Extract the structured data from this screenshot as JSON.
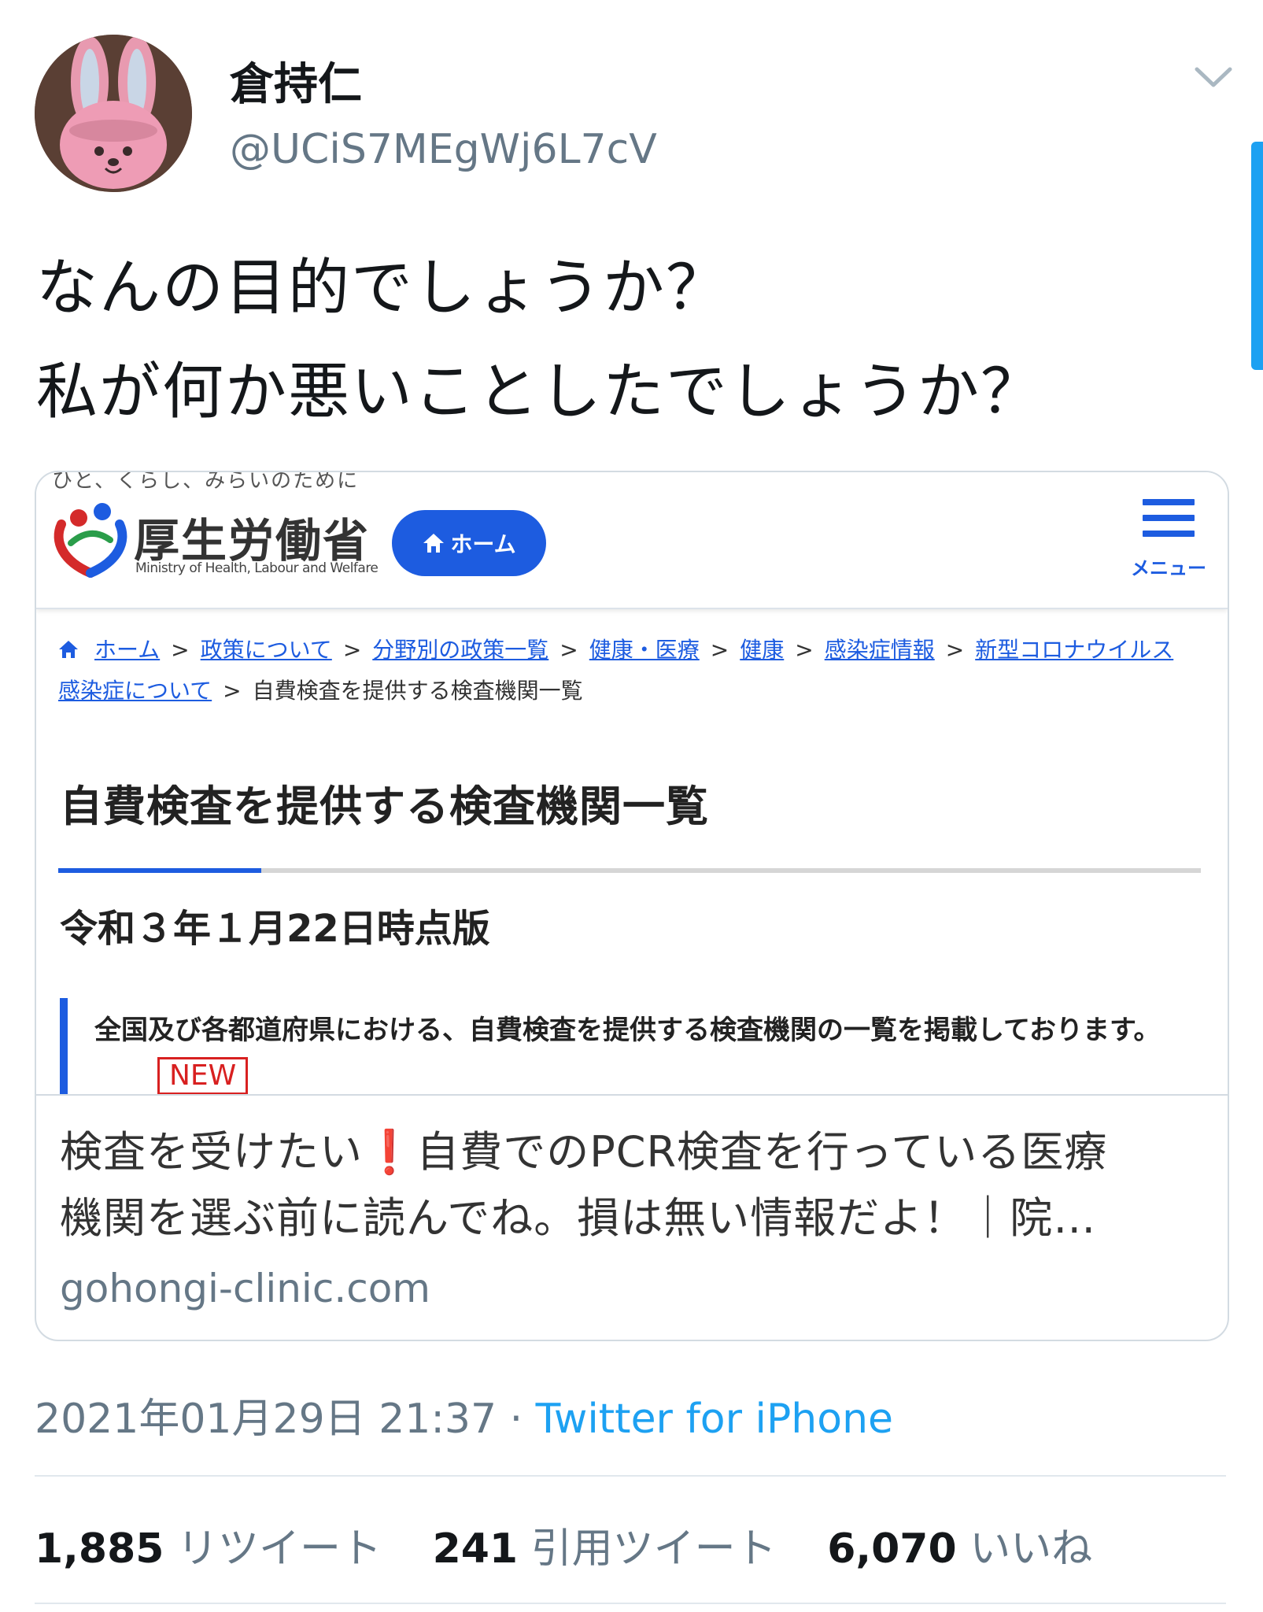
{
  "tweet": {
    "display_name": "倉持仁",
    "handle": "@UCiS7MEgWj6L7cV",
    "text_lines": [
      "なんの目的でしょうか？",
      "私が何か悪いことしたでしょうか？"
    ],
    "timestamp": "2021年01月29日 21:37",
    "separator": " · ",
    "client": "Twitter for iPhone"
  },
  "card": {
    "image": {
      "slogan": "ひと、くらし、みらいのために",
      "site_name": "厚生労働省",
      "site_name_en": "Ministry of Health, Labour and Welfare",
      "home_button": "ホーム",
      "menu_label": "メニュー",
      "breadcrumb": {
        "links": [
          "ホーム",
          "政策について",
          "分野別の政策一覧",
          "健康・医療",
          "健康",
          "感染症情報",
          "新型コロナウイルス感染症について"
        ],
        "current": "自費検査を提供する検査機関一覧",
        "separator": ">"
      },
      "page_heading": "自費検査を提供する検査機関一覧",
      "date_heading": "令和３年１月22日時点版",
      "notice_text": "全国及び各都道府県における、自費検査を提供する検査機関の一覧を掲載しております。",
      "new_badge": "NEW"
    },
    "title_line1": "検査を受けたい❗自費でのPCR検査を行っている医療",
    "title_line2": "機関を選ぶ前に読んでね。損は無い情報だよ！｜院…",
    "domain": "gohongi-clinic.com"
  },
  "stats": [
    {
      "count": "1,885",
      "label": "リツイート"
    },
    {
      "count": "241",
      "label": "引用ツイート"
    },
    {
      "count": "6,070",
      "label": "いいね"
    }
  ],
  "colors": {
    "accent": "#1da1f2",
    "mhlw_blue": "#1d5ce0",
    "new_red": "#d82020",
    "muted": "#657786"
  }
}
